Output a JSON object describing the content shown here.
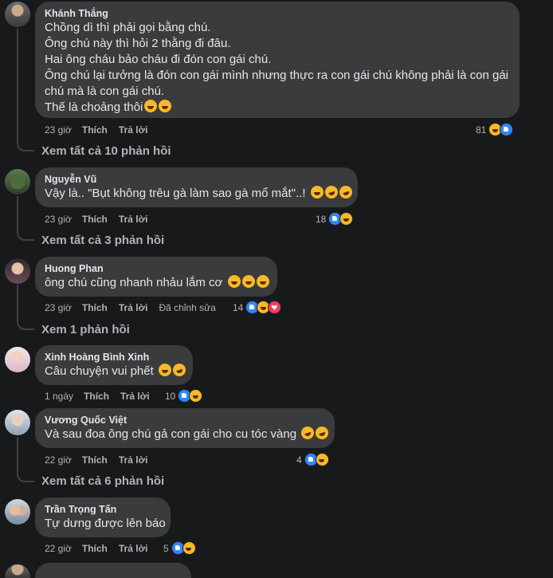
{
  "comments": [
    {
      "name": "Khánh Thắng",
      "lines": [
        "Chồng dì thì phải gọi bằng chú.",
        "Ông chú này thì hỏi 2 thằng đi đâu.",
        "Hai ông cháu bảo cháu đi đón con gái chú.",
        "Ông chú lại tưởng là đón con gái mình nhưng thực ra con gái chú không phải là con gái",
        "chú mà là con gái chú.",
        "Thế là choảng thôi"
      ],
      "time": "23 giờ",
      "like": "Thích",
      "reply": "Trả lời",
      "reactions": "81",
      "replies": "Xem tất cả 10 phản hồi"
    },
    {
      "name": "Nguyễn Vũ",
      "lines": [
        "Vậy là.. \"Bụt không trêu gà làm sao gà mổ mắt\"..!"
      ],
      "time": "23 giờ",
      "like": "Thích",
      "reply": "Trả lời",
      "reactions": "18",
      "replies": "Xem tất cả 3 phản hồi"
    },
    {
      "name": "Huong Phan",
      "lines": [
        "ông chú cũng nhanh nhảu lắm cơ"
      ],
      "time": "23 giờ",
      "like": "Thích",
      "reply": "Trả lời",
      "edited": "Đã chỉnh sửa",
      "reactions": "14",
      "replies": "Xem 1 phản hồi"
    },
    {
      "name": "Xinh Hoàng Bình Xinh",
      "lines": [
        "Câu chuyện vui phết"
      ],
      "time": "1 ngày",
      "like": "Thích",
      "reply": "Trả lời",
      "reactions": "10"
    },
    {
      "name": "Vương Quốc Việt",
      "lines": [
        "Và sau đoa ông chú gả con gái cho cu tóc vàng"
      ],
      "time": "22 giờ",
      "like": "Thích",
      "reply": "Trả lời",
      "reactions": "4",
      "replies": "Xem tất cả 6 phản hồi"
    },
    {
      "name": "Trần Trọng Tấn",
      "lines": [
        "Tự dưng được lên báo"
      ],
      "time": "22 giờ",
      "like": "Thích",
      "reply": "Trả lời",
      "reactions": "5"
    }
  ],
  "colors": {
    "background": "#18191a",
    "bubble": "#3a3b3c",
    "like": "#2d88ff",
    "haha": "#f7b928",
    "love": "#f33e58"
  }
}
